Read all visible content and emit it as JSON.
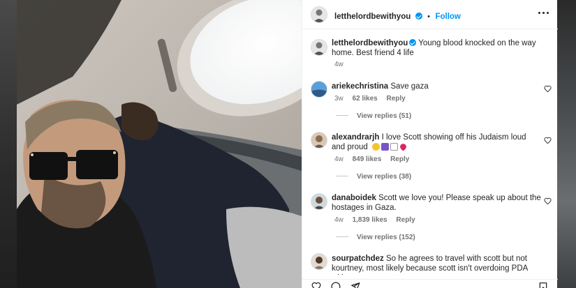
{
  "post": {
    "author": "letthelordbewithyou",
    "separator": "•",
    "follow_label": "Follow",
    "caption_text": "Young blood knocked on the way home. Best friend 4 life",
    "caption_age": "4w"
  },
  "comments": [
    {
      "user": "ariekechristina",
      "text": "Save gaza",
      "age": "3w",
      "likes": "62 likes",
      "reply_label": "Reply",
      "view_replies": "View replies (51)"
    },
    {
      "user": "alexandrarjh",
      "text": "I love Scott showing off his Judaism loud and proud",
      "age": "4w",
      "likes": "849 likes",
      "reply_label": "Reply",
      "view_replies": "View replies (38)"
    },
    {
      "user": "danaboidek",
      "text": "Scott we love you! Please speak up about the hostages in Gaza.",
      "age": "4w",
      "likes": "1,839 likes",
      "reply_label": "Reply",
      "view_replies": "View replies (152)"
    },
    {
      "user": "sourpatchdez",
      "text": "So he agrees to travel with scott but not kourtney, most likely because scott isn't overdoing PDA with a"
    }
  ],
  "icons": {
    "verified": "verified-badge-icon",
    "more": "more-options-icon",
    "like": "heart-icon",
    "comment": "comment-icon",
    "share": "share-icon",
    "save": "bookmark-icon"
  },
  "colors": {
    "accent": "#0095f6",
    "text": "#262626",
    "muted": "#737373",
    "border": "#efefef"
  }
}
